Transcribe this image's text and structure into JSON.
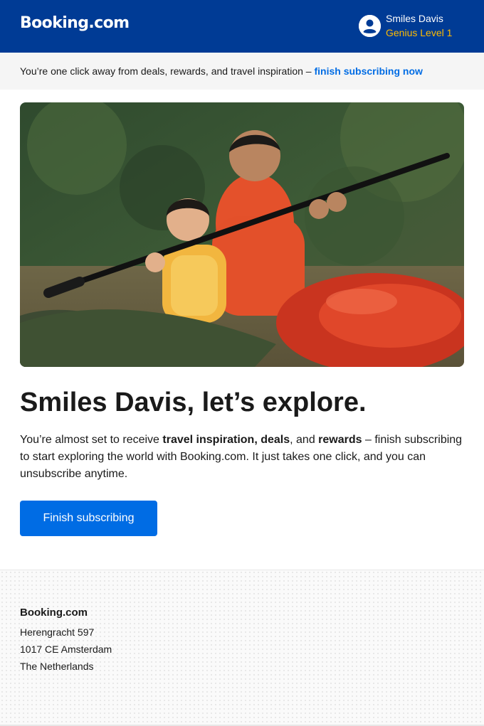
{
  "header": {
    "logo_text": "Booking.com",
    "user_name": "Smiles Davis",
    "genius_level": "Genius Level 1",
    "background_color": "#003b95",
    "genius_color": "#febb02"
  },
  "banner": {
    "text": "You’re one click away from deals, rewards, and travel inspiration – ",
    "link_text": "finish subscribing now",
    "link_color": "#006ce4"
  },
  "hero": {
    "icon": "hero-photo-kayak"
  },
  "main": {
    "headline": "Smiles Davis, let’s explore.",
    "body": {
      "part1": "You’re almost set to receive ",
      "bold1": "travel inspiration, deals",
      "part2": ", and ",
      "bold2": "rewards",
      "part3": " – finish subscribing to start exploring the world with Booking.com. It just takes one click, and you can unsubscribe anytime."
    },
    "cta_label": "Finish subscribing",
    "cta_color": "#006ce4"
  },
  "footer": {
    "brand": "Booking.com",
    "address_line1": "Herengracht 597",
    "address_line2": "1017 CE Amsterdam",
    "address_line3": "The Netherlands"
  }
}
